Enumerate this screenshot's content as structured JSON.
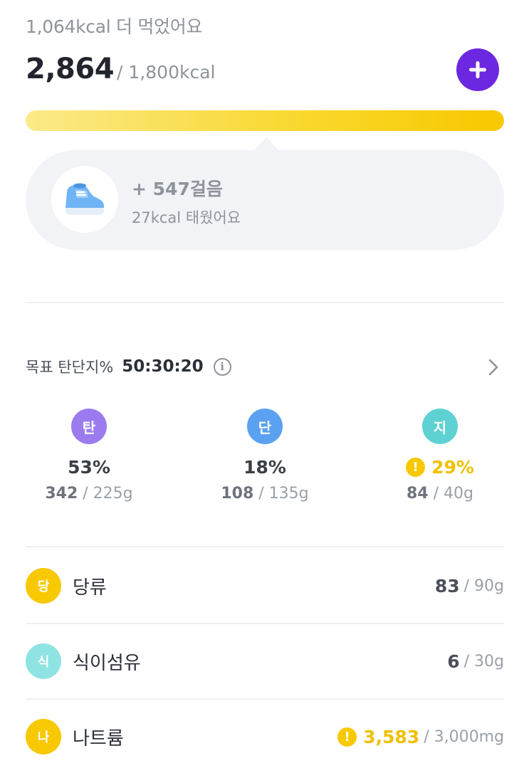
{
  "summary": {
    "over_text": "1,064kcal 더 먹었어요",
    "current_kcal": "2,864",
    "goal_kcal": "/ 1,800kcal",
    "progress_ratio": 1.0,
    "progress_colors": [
      "#fbea8a",
      "#f8c800"
    ]
  },
  "add_button": {
    "icon": "plus-icon",
    "color": "#6b28e0"
  },
  "steps": {
    "icon": "sneaker-icon",
    "title": "+ 547걸음",
    "burned": "27kcal 태웠어요"
  },
  "macros": {
    "label": "목표 탄단지%",
    "ratio": "50:30:20",
    "info_icon": "info-icon",
    "chevron_icon": "chevron-right-icon",
    "items": [
      {
        "badge": "탄",
        "color": "#9b7bef",
        "percent": "53%",
        "current": "342",
        "goal": "/ 225g",
        "warning": false
      },
      {
        "badge": "단",
        "color": "#5aa1f2",
        "percent": "18%",
        "current": "108",
        "goal": "/ 135g",
        "warning": false
      },
      {
        "badge": "지",
        "color": "#5ed2d3",
        "percent": "29%",
        "current": "84",
        "goal": "/ 40g",
        "warning": true,
        "warning_color": "#f8c800"
      }
    ]
  },
  "nutrients": [
    {
      "badge": "당",
      "color": "#f8c800",
      "name": "당류",
      "current": "83",
      "goal": "/ 90g",
      "warning": false
    },
    {
      "badge": "식",
      "color": "#8fe3e3",
      "name": "식이섬유",
      "current": "6",
      "goal": "/ 30g",
      "warning": false
    },
    {
      "badge": "나",
      "color": "#f8c800",
      "name": "나트륨",
      "current": "3,583",
      "goal": "/ 3,000mg",
      "warning": true
    }
  ],
  "warning_mark": "!"
}
